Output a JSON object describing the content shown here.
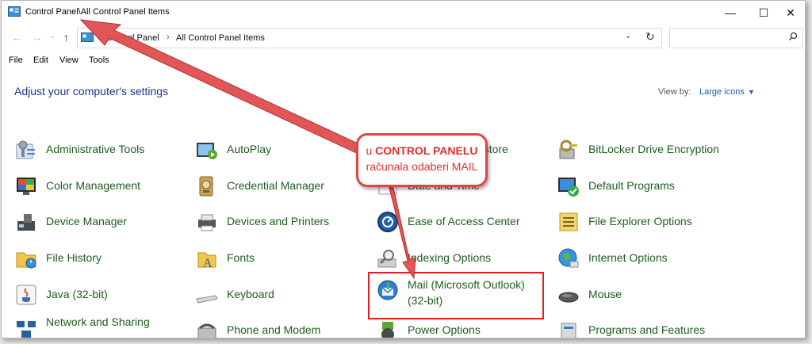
{
  "window": {
    "title": "Control Panel\\All Control Panel Items",
    "controls": {
      "minimize": "—",
      "maximize": "☐",
      "close": "✕"
    }
  },
  "address_bar": {
    "crumbs": [
      "Control Panel",
      "All Control Panel Items"
    ],
    "separator": "›",
    "dropdown": "⌄",
    "refresh": "↻"
  },
  "nav": {
    "back": "←",
    "forward": "→",
    "recent": "⌄",
    "up": "↑"
  },
  "search": {
    "placeholder": "",
    "icon": "search-icon"
  },
  "menu": [
    "File",
    "Edit",
    "View",
    "Tools"
  ],
  "heading": "Adjust your computer's settings",
  "view_by": {
    "label": "View by:",
    "value": "Large icons"
  },
  "items": [
    {
      "label": "Administrative Tools",
      "icon": "administrative-tools-icon"
    },
    {
      "label": "AutoPlay",
      "icon": "autoplay-icon"
    },
    {
      "label": "Backup and Restore",
      "icon": "backup-restore-icon"
    },
    {
      "label": "BitLocker Drive Encryption",
      "icon": "bitlocker-icon"
    },
    {
      "label": "Color Management",
      "icon": "color-management-icon"
    },
    {
      "label": "Credential Manager",
      "icon": "credential-manager-icon"
    },
    {
      "label": "Date and Time",
      "icon": "date-time-icon"
    },
    {
      "label": "Default Programs",
      "icon": "default-programs-icon"
    },
    {
      "label": "Device Manager",
      "icon": "device-manager-icon"
    },
    {
      "label": "Devices and Printers",
      "icon": "devices-printers-icon"
    },
    {
      "label": "Ease of Access Center",
      "icon": "ease-of-access-icon"
    },
    {
      "label": "File Explorer Options",
      "icon": "file-explorer-options-icon"
    },
    {
      "label": "File History",
      "icon": "file-history-icon"
    },
    {
      "label": "Fonts",
      "icon": "fonts-icon"
    },
    {
      "label": "Indexing Options",
      "icon": "indexing-options-icon"
    },
    {
      "label": "Internet Options",
      "icon": "internet-options-icon"
    },
    {
      "label": "Java (32-bit)",
      "icon": "java-icon"
    },
    {
      "label": "Keyboard",
      "icon": "keyboard-icon"
    },
    {
      "label": "Mail (Microsoft Outlook)",
      "label2": "(32-bit)",
      "icon": "mail-icon"
    },
    {
      "label": "Mouse",
      "icon": "mouse-icon"
    },
    {
      "label": "Network and Sharing",
      "icon": "network-sharing-icon"
    },
    {
      "label": "Phone and Modem",
      "icon": "phone-modem-icon"
    },
    {
      "label": "Power Options",
      "icon": "power-options-icon"
    },
    {
      "label": "Programs and Features",
      "icon": "programs-features-icon"
    }
  ],
  "annotation": {
    "line1_prefix": "u ",
    "line1_bold": "CONTROL PANELU",
    "line2": "računala odaberi MAIL",
    "color": "#e04545"
  },
  "colors": {
    "link": "#1e5c1e",
    "heading": "#1e3287",
    "accent": "#1a5fb4"
  }
}
